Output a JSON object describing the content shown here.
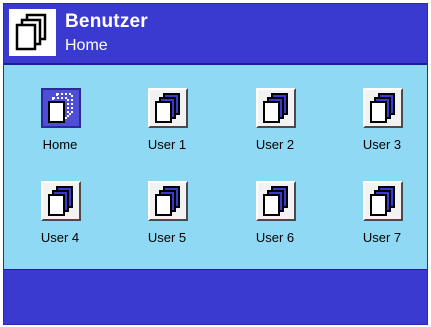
{
  "header": {
    "title": "Benutzer",
    "subtitle": "Home",
    "icon": "profile-stack-icon"
  },
  "profiles": [
    {
      "label": "Home",
      "icon": "profile-stack-icon",
      "selected": true
    },
    {
      "label": "User 1",
      "icon": "profile-stack-icon",
      "selected": false
    },
    {
      "label": "User 2",
      "icon": "profile-stack-icon",
      "selected": false
    },
    {
      "label": "User 3",
      "icon": "profile-stack-icon",
      "selected": false
    },
    {
      "label": "User 4",
      "icon": "profile-stack-icon",
      "selected": false
    },
    {
      "label": "User 5",
      "icon": "profile-stack-icon",
      "selected": false
    },
    {
      "label": "User 6",
      "icon": "profile-stack-icon",
      "selected": false
    },
    {
      "label": "User 7",
      "icon": "profile-stack-icon",
      "selected": false
    }
  ],
  "colors": {
    "header_bg": "#3a3ad0",
    "content_bg": "#8fd9f4",
    "selected_tile_bg": "#4f4fd6"
  }
}
